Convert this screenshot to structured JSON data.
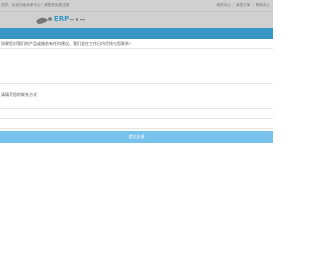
{
  "top_bar": {
    "welcome_text": "您好，欢迎光临卖家中心！请登录免费注册",
    "links": [
      "我的中心",
      "我的订单",
      "帮助中心"
    ]
  },
  "header": {
    "logo_text": "ERP"
  },
  "form": {
    "intro_text": "如果您对我们的产品或服务有任何建议，我们会在工作日内尽快与您联系！",
    "contact_label": "请填写您的联系方式",
    "submit_label": "提交反馈"
  },
  "colors": {
    "accent": "#0c9be6",
    "submit_bg": "#78c3ec"
  }
}
